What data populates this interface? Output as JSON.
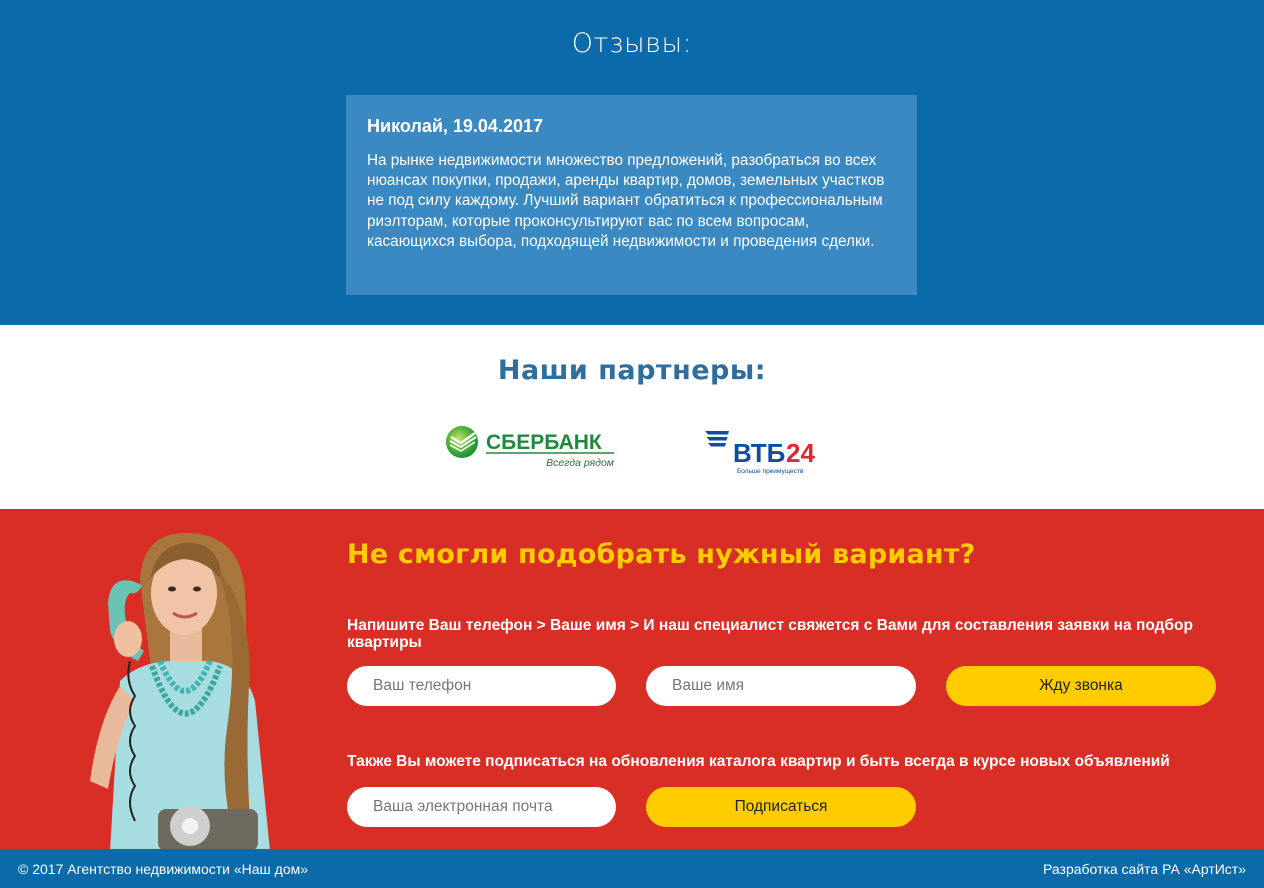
{
  "reviews": {
    "title": "Отзывы:",
    "card": {
      "author": "Николай, 19.04.2017",
      "text": "На рынке недвижимости множество предложений, разобраться во всех нюансах покупки, продажи, аренды квартир, домов, земельных участков не под силу каждому. Лучший вариант обратиться к профессиональным риэлторам, которые проконсультируют вас по всем вопросам, касающихся выбора, подходящей недвижимости и проведения сделки."
    }
  },
  "partners": {
    "title": "Наши партнеры:",
    "logos": [
      {
        "name": "СБЕРБАНК",
        "tagline": "Всегда рядом"
      },
      {
        "name": "ВТБ24",
        "tagline": "Больше преимуществ"
      }
    ]
  },
  "callback": {
    "title": "Не смогли подобрать нужный вариант?",
    "text1": "Напишите Ваш телефон > Ваше имя > И наш специалист свяжется с Вами для составления заявки на подбор квартиры",
    "phone_placeholder": "Ваш телефон",
    "name_placeholder": "Ваше имя",
    "call_button": "Жду звонка",
    "text2": "Также Вы можете подписаться на обновления каталога квартир и быть всегда в курсе новых объявлений",
    "email_placeholder": "Ваша электронная почта",
    "subscribe_button": "Подписаться"
  },
  "footer": {
    "copyright": "© 2017 Агентство недвижимости «Наш дом»",
    "developer": "Разработка сайта РА «АртИст»"
  },
  "colors": {
    "blue": "#0b6aaa",
    "card": "#3a89c2",
    "red": "#d82e26",
    "yellow": "#ffcc00"
  }
}
